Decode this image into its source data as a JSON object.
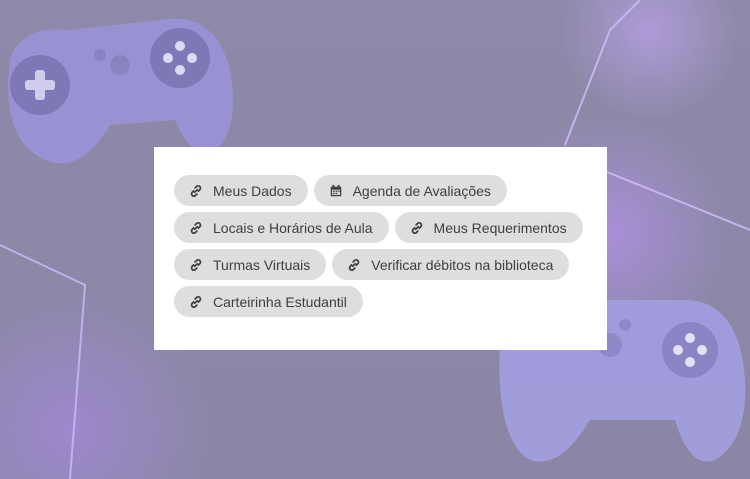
{
  "links": [
    {
      "label": "Meus Dados",
      "icon": "link-icon"
    },
    {
      "label": "Agenda de Avaliações",
      "icon": "calendar-icon"
    },
    {
      "label": "Locais e Horários de Aula",
      "icon": "link-icon"
    },
    {
      "label": "Meus Requerimentos",
      "icon": "link-icon"
    },
    {
      "label": "Turmas Virtuais",
      "icon": "link-icon"
    },
    {
      "label": "Verificar débitos na biblioteca",
      "icon": "link-icon"
    },
    {
      "label": "Carteirinha Estudantil",
      "icon": "link-icon"
    }
  ],
  "colors": {
    "chip_background": "#dedede",
    "chip_text": "#3f3f3f",
    "card_background": "#ffffff",
    "page_background": "#8f8aa8"
  }
}
